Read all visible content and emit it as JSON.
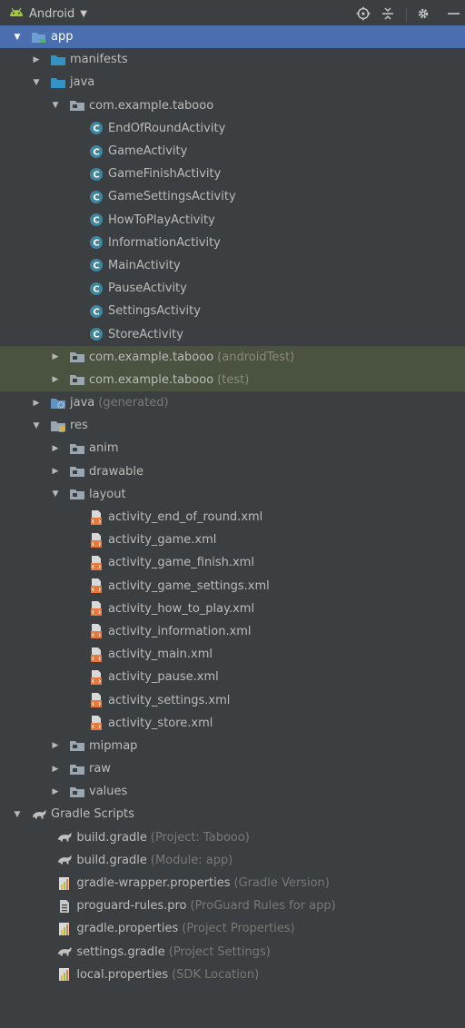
{
  "toolbar": {
    "view_label": "Android",
    "icons": [
      "android-icon",
      "caret-down-icon",
      "locate-icon",
      "collapse-all-icon",
      "gear-icon",
      "hide-icon"
    ]
  },
  "tree": [
    {
      "label": "app",
      "hint": "",
      "icon": "module-folder",
      "depth": 0,
      "arrow": "down",
      "state": "selected"
    },
    {
      "label": "manifests",
      "hint": "",
      "icon": "folder-blue",
      "depth": 1,
      "arrow": "right"
    },
    {
      "label": "java",
      "hint": "",
      "icon": "folder-blue",
      "depth": 1,
      "arrow": "down"
    },
    {
      "label": "com.example.tabooo",
      "hint": "",
      "icon": "package",
      "depth": 2,
      "arrow": "down"
    },
    {
      "label": "EndOfRoundActivity",
      "hint": "",
      "icon": "class",
      "depth": 3,
      "arrow": "none"
    },
    {
      "label": "GameActivity",
      "hint": "",
      "icon": "class",
      "depth": 3,
      "arrow": "none"
    },
    {
      "label": "GameFinishActivity",
      "hint": "",
      "icon": "class",
      "depth": 3,
      "arrow": "none"
    },
    {
      "label": "GameSettingsActivity",
      "hint": "",
      "icon": "class",
      "depth": 3,
      "arrow": "none"
    },
    {
      "label": "HowToPlayActivity",
      "hint": "",
      "icon": "class",
      "depth": 3,
      "arrow": "none"
    },
    {
      "label": "InformationActivity",
      "hint": "",
      "icon": "class",
      "depth": 3,
      "arrow": "none"
    },
    {
      "label": "MainActivity",
      "hint": "",
      "icon": "class",
      "depth": 3,
      "arrow": "none"
    },
    {
      "label": "PauseActivity",
      "hint": "",
      "icon": "class",
      "depth": 3,
      "arrow": "none"
    },
    {
      "label": "SettingsActivity",
      "hint": "",
      "icon": "class",
      "depth": 3,
      "arrow": "none"
    },
    {
      "label": "StoreActivity",
      "hint": "",
      "icon": "class",
      "depth": 3,
      "arrow": "none"
    },
    {
      "label": "com.example.tabooo",
      "hint": "(androidTest)",
      "icon": "package",
      "depth": 2,
      "arrow": "right",
      "state": "test"
    },
    {
      "label": "com.example.tabooo",
      "hint": "(test)",
      "icon": "package",
      "depth": 2,
      "arrow": "right",
      "state": "test"
    },
    {
      "label": "java",
      "hint": "(generated)",
      "icon": "generated-folder",
      "depth": 1,
      "arrow": "right"
    },
    {
      "label": "res",
      "hint": "",
      "icon": "res-folder",
      "depth": 1,
      "arrow": "down"
    },
    {
      "label": "anim",
      "hint": "",
      "icon": "package",
      "depth": 2,
      "arrow": "right"
    },
    {
      "label": "drawable",
      "hint": "",
      "icon": "package",
      "depth": 2,
      "arrow": "right"
    },
    {
      "label": "layout",
      "hint": "",
      "icon": "package",
      "depth": 2,
      "arrow": "down"
    },
    {
      "label": "activity_end_of_round.xml",
      "hint": "",
      "icon": "xml",
      "depth": 3,
      "arrow": "none"
    },
    {
      "label": "activity_game.xml",
      "hint": "",
      "icon": "xml",
      "depth": 3,
      "arrow": "none"
    },
    {
      "label": "activity_game_finish.xml",
      "hint": "",
      "icon": "xml",
      "depth": 3,
      "arrow": "none"
    },
    {
      "label": "activity_game_settings.xml",
      "hint": "",
      "icon": "xml",
      "depth": 3,
      "arrow": "none"
    },
    {
      "label": "activity_how_to_play.xml",
      "hint": "",
      "icon": "xml",
      "depth": 3,
      "arrow": "none"
    },
    {
      "label": "activity_information.xml",
      "hint": "",
      "icon": "xml",
      "depth": 3,
      "arrow": "none"
    },
    {
      "label": "activity_main.xml",
      "hint": "",
      "icon": "xml",
      "depth": 3,
      "arrow": "none"
    },
    {
      "label": "activity_pause.xml",
      "hint": "",
      "icon": "xml",
      "depth": 3,
      "arrow": "none"
    },
    {
      "label": "activity_settings.xml",
      "hint": "",
      "icon": "xml",
      "depth": 3,
      "arrow": "none"
    },
    {
      "label": "activity_store.xml",
      "hint": "",
      "icon": "xml",
      "depth": 3,
      "arrow": "none"
    },
    {
      "label": "mipmap",
      "hint": "",
      "icon": "package",
      "depth": 2,
      "arrow": "right"
    },
    {
      "label": "raw",
      "hint": "",
      "icon": "package",
      "depth": 2,
      "arrow": "right"
    },
    {
      "label": "values",
      "hint": "",
      "icon": "package",
      "depth": 2,
      "arrow": "right"
    },
    {
      "label": "Gradle Scripts",
      "hint": "",
      "icon": "gradle",
      "depth": 0,
      "arrow": "down"
    },
    {
      "label": "build.gradle",
      "hint": "(Project: Tabooo)",
      "icon": "gradle",
      "depth": 1.35,
      "arrow": "none"
    },
    {
      "label": "build.gradle",
      "hint": "(Module: app)",
      "icon": "gradle",
      "depth": 1.35,
      "arrow": "none"
    },
    {
      "label": "gradle-wrapper.properties",
      "hint": "(Gradle Version)",
      "icon": "properties",
      "depth": 1.35,
      "arrow": "none"
    },
    {
      "label": "proguard-rules.pro",
      "hint": "(ProGuard Rules for app)",
      "icon": "text-file",
      "depth": 1.35,
      "arrow": "none"
    },
    {
      "label": "gradle.properties",
      "hint": "(Project Properties)",
      "icon": "properties",
      "depth": 1.35,
      "arrow": "none"
    },
    {
      "label": "settings.gradle",
      "hint": "(Project Settings)",
      "icon": "gradle",
      "depth": 1.35,
      "arrow": "none"
    },
    {
      "label": "local.properties",
      "hint": "(SDK Location)",
      "icon": "properties",
      "depth": 1.35,
      "arrow": "none"
    }
  ],
  "colors": {
    "background": "#3c3f41",
    "selection": "#4b6eaf",
    "test_highlight": "#49533f",
    "text": "#bbbbbb",
    "hint": "#787878",
    "folder_blue": "#3592c4",
    "class_icon": "#3e86a0",
    "xml_orange": "#e9773e",
    "android_green": "#a4c639"
  }
}
